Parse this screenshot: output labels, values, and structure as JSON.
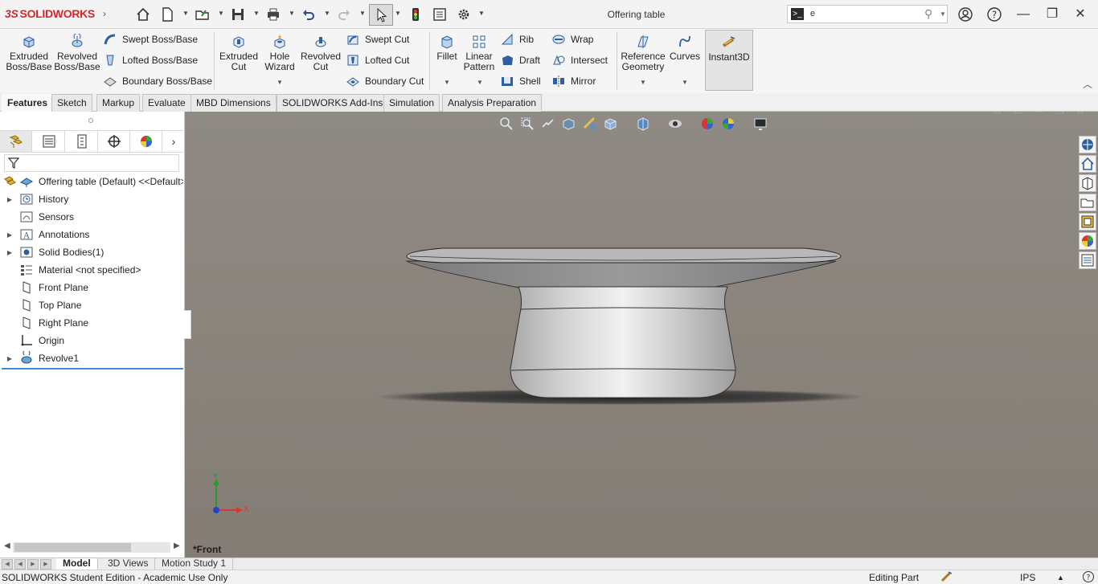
{
  "app": {
    "brand": "SOLIDWORKS",
    "document_title": "Offering table",
    "search_value": "e",
    "accent_color": "#d7262b",
    "selection_color": "#3b8ed6"
  },
  "ribbon": {
    "extruded_boss": "Extruded\nBoss/Base",
    "revolved_boss": "Revolved\nBoss/Base",
    "swept_boss": "Swept Boss/Base",
    "lofted_boss": "Lofted Boss/Base",
    "boundary_boss": "Boundary Boss/Base",
    "extruded_cut": "Extruded\nCut",
    "hole_wizard": "Hole\nWizard",
    "revolved_cut": "Revolved\nCut",
    "swept_cut": "Swept Cut",
    "lofted_cut": "Lofted Cut",
    "boundary_cut": "Boundary Cut",
    "fillet": "Fillet",
    "linear_pattern": "Linear\nPattern",
    "rib": "Rib",
    "draft": "Draft",
    "shell": "Shell",
    "wrap": "Wrap",
    "intersect": "Intersect",
    "mirror": "Mirror",
    "reference_geometry": "Reference\nGeometry",
    "curves": "Curves",
    "instant3d": "Instant3D"
  },
  "tabs": [
    "Features",
    "Sketch",
    "Markup",
    "Evaluate",
    "MBD Dimensions",
    "SOLIDWORKS Add-Ins",
    "Simulation",
    "Analysis Preparation"
  ],
  "tree": {
    "root": "Offering table (Default) <<Default>",
    "items": [
      "History",
      "Sensors",
      "Annotations",
      "Solid Bodies(1)",
      "Material <not specified>",
      "Front Plane",
      "Top Plane",
      "Right Plane",
      "Origin",
      "Revolve1"
    ]
  },
  "viewport": {
    "view_name": "*Front",
    "triad_x": "X",
    "triad_y": "Y"
  },
  "bottom_tabs": [
    "Model",
    "3D Views",
    "Motion Study 1"
  ],
  "status": {
    "edition": "SOLIDWORKS Student Edition - Academic Use Only",
    "mode": "Editing Part",
    "units": "IPS"
  }
}
